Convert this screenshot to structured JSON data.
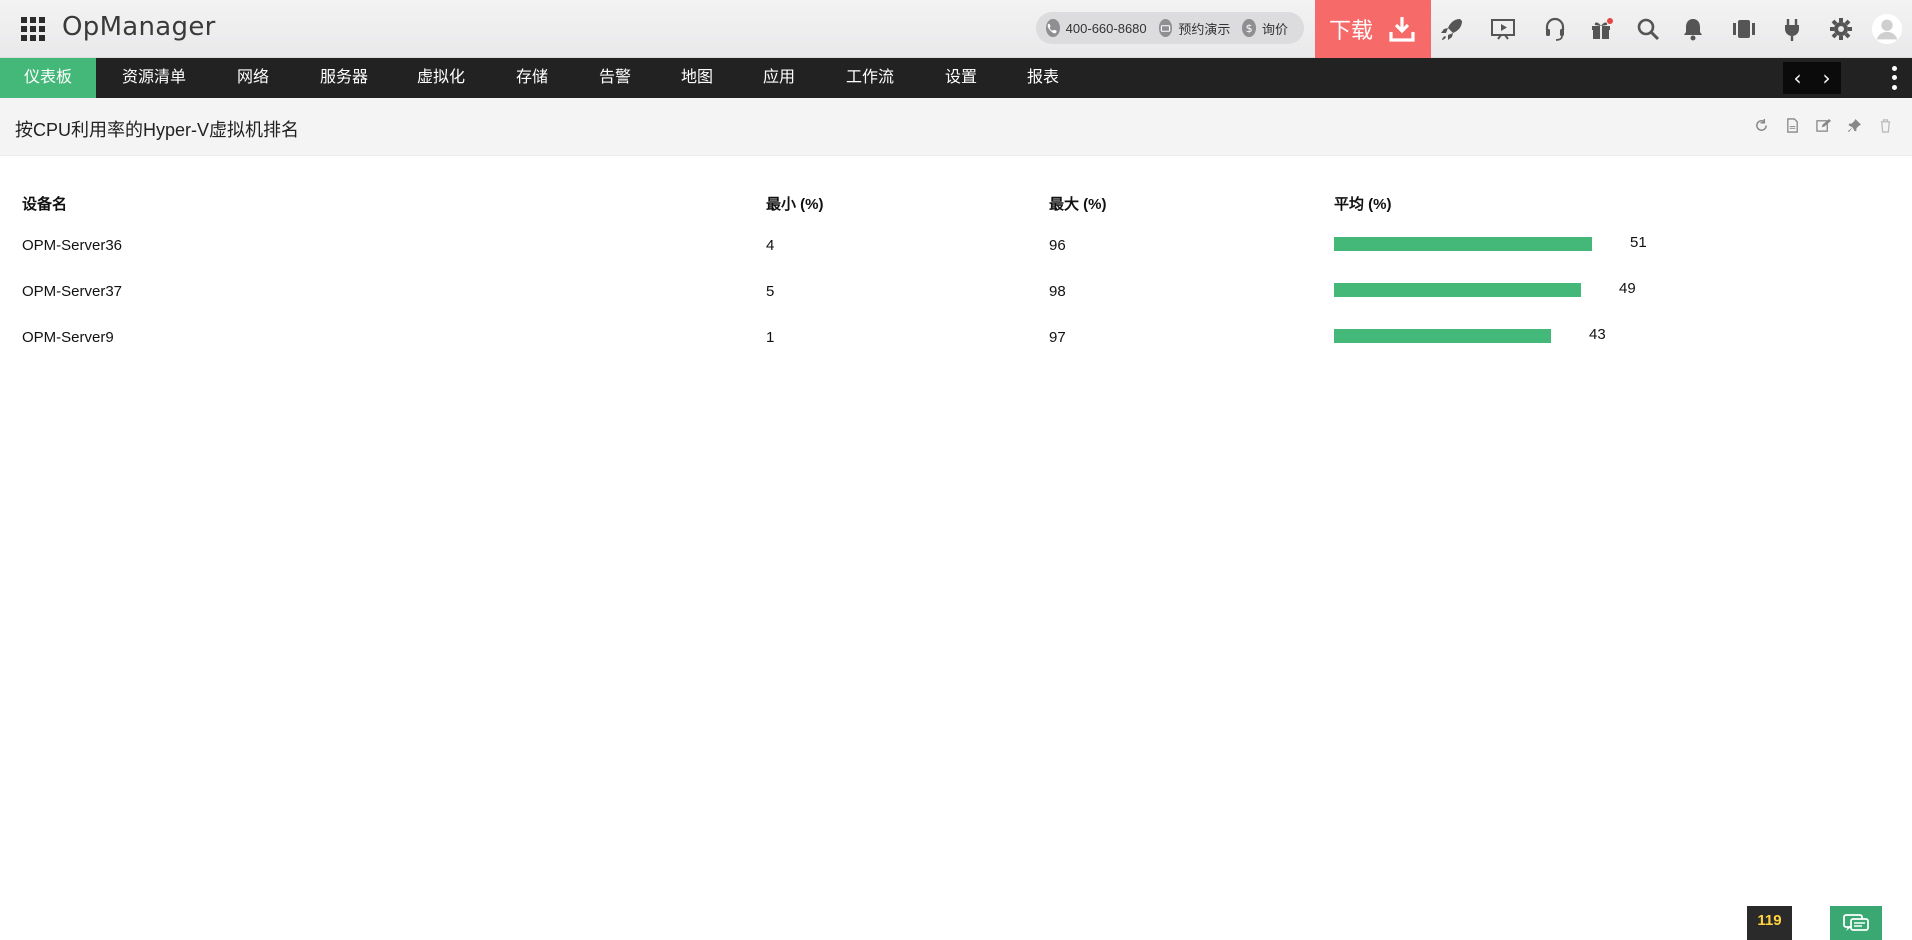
{
  "app": {
    "logo": "OpManager"
  },
  "header": {
    "phone": "400-660-8680",
    "demo": "预约演示",
    "price": "询价",
    "price_icon_glyph": "$",
    "download": "下载",
    "icons": [
      "rocket-icon",
      "presentation-icon",
      "headset-icon",
      "gift-icon",
      "search-icon",
      "bell-icon",
      "device-icon",
      "plug-icon",
      "gear-icon",
      "user-avatar-icon"
    ]
  },
  "nav": {
    "items": [
      "仪表板",
      "资源清单",
      "网络",
      "服务器",
      "虚拟化",
      "存储",
      "告警",
      "地图",
      "应用",
      "工作流",
      "设置",
      "报表"
    ],
    "active_index": 0,
    "prev": "‹",
    "next": "›"
  },
  "widget": {
    "title": "按CPU利用率的Hyper-V虚拟机排名",
    "actions": [
      "refresh-icon",
      "export-pdf-icon",
      "edit-icon",
      "pin-icon",
      "delete-icon"
    ],
    "columns": {
      "device": "设备名",
      "min": "最小 (%)",
      "max": "最大 (%)",
      "avg": "平均 (%)"
    },
    "rows": [
      {
        "device": "OPM-Server36",
        "min": "4",
        "max": "96",
        "avg": "51",
        "avg_value": 51
      },
      {
        "device": "OPM-Server37",
        "min": "5",
        "max": "98",
        "avg": "49",
        "avg_value": 49
      },
      {
        "device": "OPM-Server9",
        "min": "1",
        "max": "97",
        "avg": "43",
        "avg_value": 43
      }
    ]
  },
  "footer": {
    "alarm_count": "119"
  },
  "colors": {
    "accent_green": "#44b879",
    "download_red": "#f66a6a",
    "nav_bg": "#222222",
    "alarm_count": "#ffd23f"
  }
}
